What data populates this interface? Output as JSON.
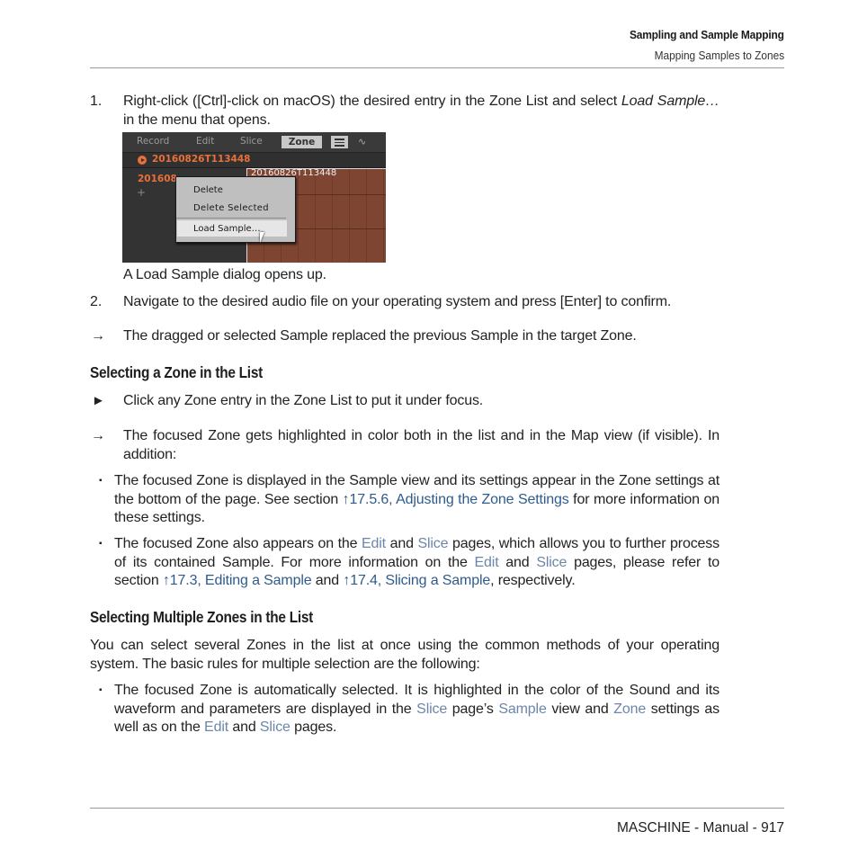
{
  "header": {
    "chapter": "Sampling and Sample Mapping",
    "section": "Mapping Samples to Zones"
  },
  "footer": {
    "text": "MASCHINE - Manual - 917"
  },
  "steps": [
    {
      "number": "1.",
      "text_before": "Right-click ([Ctrl]-click on macOS) the desired entry in the Zone List and select ",
      "italic": "Load Sample…",
      "text_after": " in the menu that opens."
    },
    {
      "number": "2.",
      "text": "Navigate to the desired audio file on your operating system and press [Enter] to confirm."
    }
  ],
  "screenshot": {
    "tabs": [
      "Record",
      "Edit",
      "Slice"
    ],
    "active_tab": "Zone",
    "menu_icon": "hamburger-icon",
    "waveform_icon": "waveform-icon",
    "sound_name": "20160826T113448",
    "zone_name_truncated": "201608",
    "add_zone": "+",
    "map_zone_label": "20160826T113448",
    "context_menu": [
      "Delete",
      "Delete Selected",
      "Load Sample…"
    ],
    "highlighted_item": "Load Sample…",
    "colors": {
      "accent_orange": "#e8713a",
      "zone_brown": "#7d4532",
      "panel_dark": "#2e2e2e",
      "menu_grey": "#bfbfbf"
    }
  },
  "caption": "A Load Sample dialog opens up.",
  "result1": {
    "arrow": "→",
    "text": "The dragged or selected Sample replaced the previous Sample in the target Zone."
  },
  "section1": {
    "heading": "Selecting a Zone in the List",
    "action_marker": "►",
    "action": "Click any Zone entry in the Zone List to put it under focus.",
    "result_arrow": "→",
    "result": "The focused Zone gets highlighted in color both in the list and in the Map view (if visible). In addition:",
    "bullets": [
      {
        "parts": [
          {
            "t": "The focused Zone is displayed in the Sample view and its settings appear in the Zone settings at the bottom of the page. See section "
          },
          {
            "t": "↑17.5.6, Adjusting the Zone Settings",
            "link": "ref"
          },
          {
            "t": " for more information on these settings."
          }
        ]
      },
      {
        "parts": [
          {
            "t": "The focused Zone also appears on the "
          },
          {
            "t": "Edit",
            "link": "ui"
          },
          {
            "t": " and "
          },
          {
            "t": "Slice",
            "link": "ui"
          },
          {
            "t": " pages, which allows you to further process of its contained Sample. For more information on the "
          },
          {
            "t": "Edit",
            "link": "ui"
          },
          {
            "t": " and "
          },
          {
            "t": "Slice",
            "link": "ui"
          },
          {
            "t": " pages, please refer to section "
          },
          {
            "t": "↑17.3, Editing a Sample",
            "link": "ref"
          },
          {
            "t": " and "
          },
          {
            "t": "↑17.4, Slicing a Sample",
            "link": "ref"
          },
          {
            "t": ", respectively."
          }
        ]
      }
    ]
  },
  "section2": {
    "heading": "Selecting Multiple Zones in the List",
    "intro": "You can select several Zones in the list at once using the common methods of your operating system. The basic rules for multiple selection are the following:",
    "bullets": [
      {
        "parts": [
          {
            "t": "The focused Zone is automatically selected. It is highlighted in the color of the Sound and its waveform and parameters are displayed in the "
          },
          {
            "t": "Slice",
            "link": "ui"
          },
          {
            "t": " page’s "
          },
          {
            "t": "Sample",
            "link": "ui"
          },
          {
            "t": " view and "
          },
          {
            "t": "Zone",
            "link": "ui"
          },
          {
            "t": " settings as well as on the "
          },
          {
            "t": "Edit",
            "link": "ui"
          },
          {
            "t": " and "
          },
          {
            "t": "Slice",
            "link": "ui"
          },
          {
            "t": " pages."
          }
        ]
      }
    ]
  },
  "bullet_marker": "▪",
  "link_colors": {
    "ui_term": "#6b86a8",
    "cross_reference": "#2f5b8c"
  }
}
